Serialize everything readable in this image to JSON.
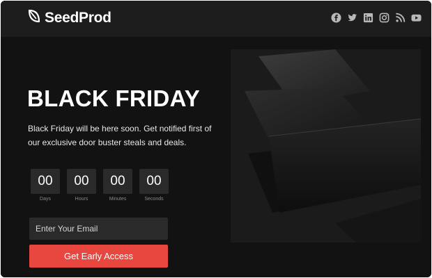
{
  "brand": {
    "name": "SeedProd",
    "logo_icon": "leaf-icon"
  },
  "social": {
    "icons": [
      "facebook-icon",
      "twitter-icon",
      "linkedin-icon",
      "instagram-icon",
      "rss-icon",
      "youtube-icon"
    ],
    "color": "#b8b8b8"
  },
  "hero": {
    "title": "BLACK FRIDAY",
    "description": "Black Friday will be here soon. Get notified first of our exclusive door buster steals and deals."
  },
  "countdown": [
    {
      "value": "00",
      "label": "Days"
    },
    {
      "value": "00",
      "label": "Hours"
    },
    {
      "value": "00",
      "label": "Minutes"
    },
    {
      "value": "00",
      "label": "Seconds"
    }
  ],
  "form": {
    "email_placeholder": "Enter Your Email",
    "button_label": "Get Early Access",
    "button_color": "#e7473e"
  }
}
